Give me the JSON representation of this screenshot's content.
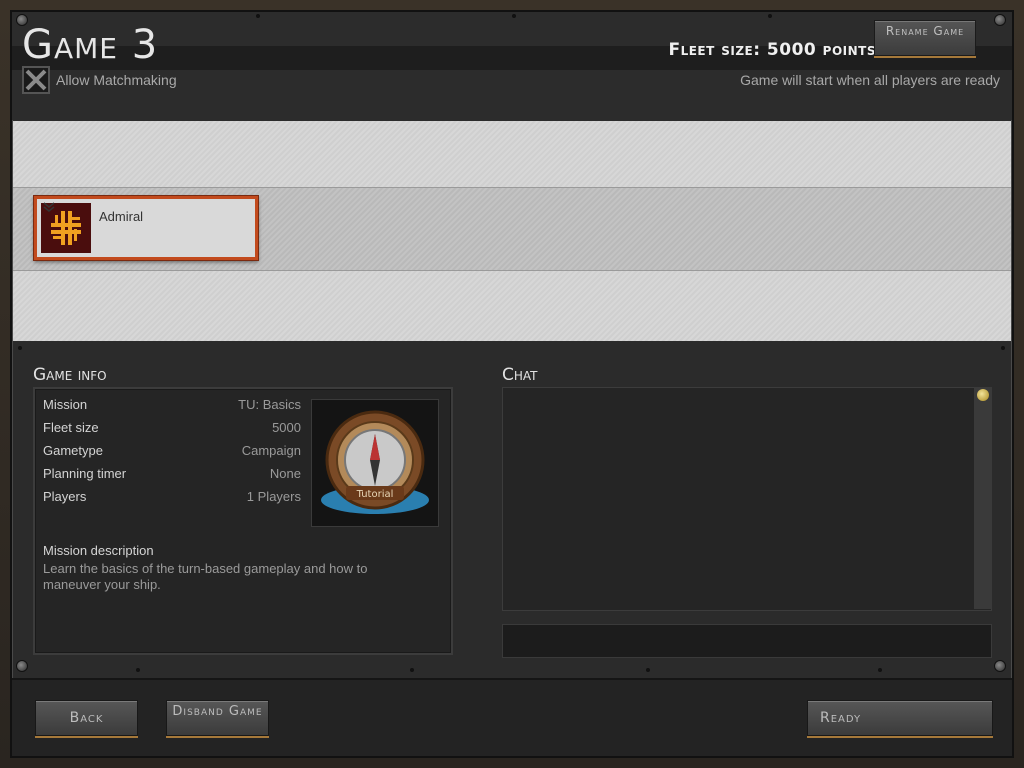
{
  "header": {
    "title": "Game 3",
    "allow_matchmaking_label": "Allow Matchmaking",
    "fleet_size_text": "Fleet size: 5000 points",
    "rename_label": "Rename Game",
    "start_note": "Game will start when all players are ready"
  },
  "players": [
    {
      "name": "Admiral",
      "emblem_icon": "gold-cross-emblem",
      "highlight_color": "#c24a1d"
    }
  ],
  "game_info": {
    "section_title": "Game info",
    "rows": [
      {
        "label": "Mission",
        "value": "TU: Basics"
      },
      {
        "label": "Fleet size",
        "value": "5000"
      },
      {
        "label": "Gametype",
        "value": "Campaign"
      },
      {
        "label": "Planning timer",
        "value": "None"
      },
      {
        "label": "Players",
        "value": "1 Players"
      }
    ],
    "mission_badge_text": "Tutorial",
    "description_title": "Mission description",
    "description": "Learn the basics of the turn-based gameplay and how to maneuver your ship."
  },
  "chat": {
    "section_title": "Chat",
    "input_value": ""
  },
  "footer": {
    "back_label": "Back",
    "disband_label": "Disband Game",
    "ready_label": "Ready"
  },
  "colors": {
    "accent_orange": "#c24a1d",
    "button_trim": "#a6793a"
  }
}
